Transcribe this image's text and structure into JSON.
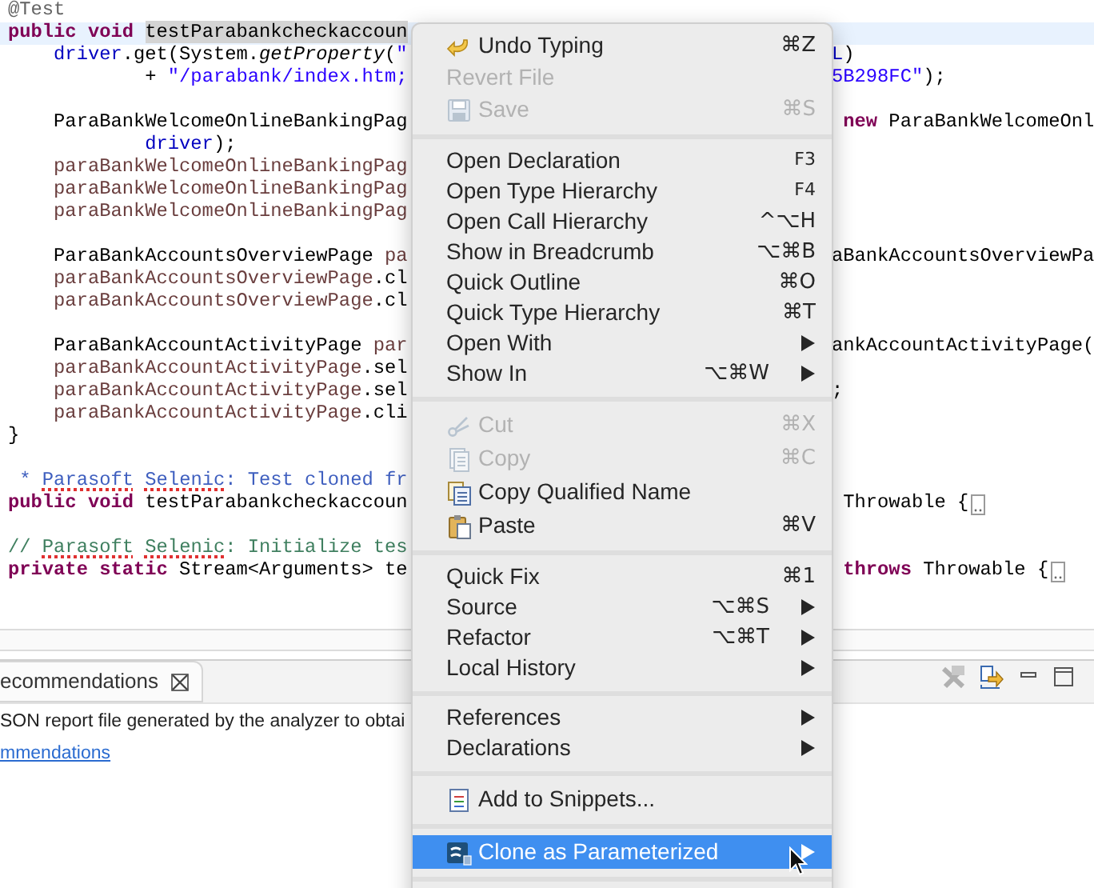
{
  "editor": {
    "lines": [
      {
        "kind": "code",
        "left": [
          {
            "kind": "annotation",
            "text": "@Test"
          }
        ]
      },
      {
        "kind": "code",
        "current": true,
        "left": [
          {
            "kind": "keyword",
            "text": "public void "
          },
          {
            "kind": "plain",
            "text": "testParabankcheckaccoun",
            "selected": true
          }
        ]
      },
      {
        "kind": "code",
        "left": [
          {
            "kind": "field",
            "text": "    driver"
          },
          {
            "kind": "plain",
            "text": ".get(System."
          },
          {
            "kind": "static",
            "text": "getProperty"
          },
          {
            "kind": "plain",
            "text": "("
          },
          {
            "kind": "string",
            "text": "\""
          }
        ],
        "right": [
          {
            "kind": "field",
            "text": "L"
          },
          {
            "kind": "plain",
            "text": ")"
          }
        ]
      },
      {
        "kind": "code",
        "left": [
          {
            "kind": "plain",
            "text": "            + "
          },
          {
            "kind": "string",
            "text": "\"/parabank/index.htm;"
          }
        ],
        "right": [
          {
            "kind": "string",
            "text": "5B298FC\""
          },
          {
            "kind": "plain",
            "text": ");"
          }
        ]
      },
      {
        "kind": "blank"
      },
      {
        "kind": "code",
        "left": [
          {
            "kind": "plain",
            "text": "    ParaBankWelcomeOnlineBankingPag"
          }
        ],
        "right": [
          {
            "kind": "keyword",
            "text": " new"
          },
          {
            "kind": "plain",
            "text": " ParaBankWelcomeOnl"
          }
        ]
      },
      {
        "kind": "code",
        "left": [
          {
            "kind": "field",
            "text": "            driver"
          },
          {
            "kind": "plain",
            "text": ");"
          }
        ]
      },
      {
        "kind": "code",
        "left": [
          {
            "kind": "local",
            "text": "    paraBankWelcomeOnlineBankingPag"
          }
        ]
      },
      {
        "kind": "code",
        "left": [
          {
            "kind": "local",
            "text": "    paraBankWelcomeOnlineBankingPag"
          }
        ]
      },
      {
        "kind": "code",
        "left": [
          {
            "kind": "local",
            "text": "    paraBankWelcomeOnlineBankingPag"
          }
        ]
      },
      {
        "kind": "blank"
      },
      {
        "kind": "code",
        "left": [
          {
            "kind": "plain",
            "text": "    ParaBankAccountsOverviewPage "
          },
          {
            "kind": "local",
            "text": "pa"
          }
        ],
        "right": [
          {
            "kind": "plain",
            "text": "aBankAccountsOverviewPa"
          }
        ]
      },
      {
        "kind": "code",
        "left": [
          {
            "kind": "local",
            "text": "    paraBankAccountsOverviewPage"
          },
          {
            "kind": "plain",
            "text": ".cl"
          }
        ]
      },
      {
        "kind": "code",
        "left": [
          {
            "kind": "local",
            "text": "    paraBankAccountsOverviewPage"
          },
          {
            "kind": "plain",
            "text": ".cl"
          }
        ]
      },
      {
        "kind": "blank"
      },
      {
        "kind": "code",
        "left": [
          {
            "kind": "plain",
            "text": "    ParaBankAccountActivityPage "
          },
          {
            "kind": "local",
            "text": "par"
          }
        ],
        "right": [
          {
            "kind": "plain",
            "text": "ankAccountActivityPage("
          }
        ]
      },
      {
        "kind": "code",
        "left": [
          {
            "kind": "local",
            "text": "    paraBankAccountActivityPage"
          },
          {
            "kind": "plain",
            "text": ".sel"
          }
        ]
      },
      {
        "kind": "code",
        "left": [
          {
            "kind": "local",
            "text": "    paraBankAccountActivityPage"
          },
          {
            "kind": "plain",
            "text": ".sel"
          }
        ],
        "right": [
          {
            "kind": "plain",
            "text": ";"
          }
        ]
      },
      {
        "kind": "code",
        "left": [
          {
            "kind": "local",
            "text": "    paraBankAccountActivityPage"
          },
          {
            "kind": "plain",
            "text": ".cli"
          }
        ]
      },
      {
        "kind": "code",
        "left": [
          {
            "kind": "plain",
            "text": "}"
          }
        ]
      },
      {
        "kind": "blank"
      },
      {
        "kind": "code",
        "left": [
          {
            "kind": "javadoc",
            "text": " * "
          },
          {
            "kind": "javadoc",
            "text": "Parasoft",
            "misspelled": true
          },
          {
            "kind": "javadoc",
            "text": " Selenic",
            "misspelled": true
          },
          {
            "kind": "javadoc",
            "text": ": Test cloned fr"
          }
        ]
      },
      {
        "kind": "code",
        "left": [
          {
            "kind": "keyword",
            "text": "public void"
          },
          {
            "kind": "plain",
            "text": " testParabankcheckaccoun"
          }
        ],
        "right": [
          {
            "kind": "plain",
            "text": " Throwable {"
          }
        ],
        "folded": true
      },
      {
        "kind": "blank"
      },
      {
        "kind": "code",
        "left": [
          {
            "kind": "comment",
            "text": "// "
          },
          {
            "kind": "comment",
            "text": "Parasoft",
            "misspelled": true
          },
          {
            "kind": "comment",
            "text": " Selenic",
            "misspelled": true
          },
          {
            "kind": "comment",
            "text": ": Initialize tes"
          }
        ]
      },
      {
        "kind": "code",
        "left": [
          {
            "kind": "keyword",
            "text": "private static"
          },
          {
            "kind": "plain",
            "text": " Stream<Arguments> te"
          }
        ],
        "right": [
          {
            "kind": "keyword",
            "text": " throws"
          },
          {
            "kind": "plain",
            "text": " Throwable {"
          }
        ],
        "folded": true
      }
    ]
  },
  "panel": {
    "tab": {
      "label": "ecommendations"
    },
    "message": "SON report file generated by the analyzer to obtai",
    "link": "mmendations"
  },
  "menu": {
    "groups": [
      [
        {
          "label": "Undo Typing",
          "shortcut": "⌘Z",
          "submenu": false,
          "disabled": false,
          "selected": false
        },
        {
          "label": "Revert File",
          "submenu": false,
          "disabled": true,
          "selected": false
        },
        {
          "label": "Save",
          "shortcut": "⌘S",
          "submenu": false,
          "disabled": true,
          "selected": false
        }
      ],
      [
        {
          "label": "Open Declaration",
          "shortcut": "F3",
          "submenu": false,
          "disabled": false,
          "selected": false
        },
        {
          "label": "Open Type Hierarchy",
          "shortcut": "F4",
          "submenu": false,
          "disabled": false,
          "selected": false
        },
        {
          "label": "Open Call Hierarchy",
          "shortcut": "^⌥H",
          "submenu": false,
          "disabled": false,
          "selected": false
        },
        {
          "label": "Show in Breadcrumb",
          "shortcut": "⌥⌘B",
          "submenu": false,
          "disabled": false,
          "selected": false
        },
        {
          "label": "Quick Outline",
          "shortcut": "⌘O",
          "submenu": false,
          "disabled": false,
          "selected": false
        },
        {
          "label": "Quick Type Hierarchy",
          "shortcut": "⌘T",
          "submenu": false,
          "disabled": false,
          "selected": false
        },
        {
          "label": "Open With",
          "submenu": true,
          "disabled": false,
          "selected": false
        },
        {
          "label": "Show In",
          "shortcut": "⌥⌘W",
          "submenu": true,
          "disabled": false,
          "selected": false
        }
      ],
      [
        {
          "label": "Cut",
          "shortcut": "⌘X",
          "submenu": false,
          "disabled": true,
          "selected": false
        },
        {
          "label": "Copy",
          "shortcut": "⌘C",
          "submenu": false,
          "disabled": true,
          "selected": false
        },
        {
          "label": "Copy Qualified Name",
          "submenu": false,
          "disabled": false,
          "selected": false
        },
        {
          "label": "Paste",
          "shortcut": "⌘V",
          "submenu": false,
          "disabled": false,
          "selected": false
        }
      ],
      [
        {
          "label": "Quick Fix",
          "shortcut": "⌘1",
          "submenu": false,
          "disabled": false,
          "selected": false
        },
        {
          "label": "Source",
          "shortcut": "⌥⌘S",
          "submenu": true,
          "disabled": false,
          "selected": false
        },
        {
          "label": "Refactor",
          "shortcut": "⌥⌘T",
          "submenu": true,
          "disabled": false,
          "selected": false
        },
        {
          "label": "Local History",
          "submenu": true,
          "disabled": false,
          "selected": false
        }
      ],
      [
        {
          "label": "References",
          "submenu": true,
          "disabled": false,
          "selected": false
        },
        {
          "label": "Declarations",
          "submenu": true,
          "disabled": false,
          "selected": false
        }
      ],
      [
        {
          "label": "Add to Snippets...",
          "submenu": false,
          "disabled": false,
          "selected": false
        }
      ],
      [
        {
          "label": "Clone as Parameterized",
          "submenu": true,
          "disabled": false,
          "selected": true
        }
      ]
    ]
  }
}
